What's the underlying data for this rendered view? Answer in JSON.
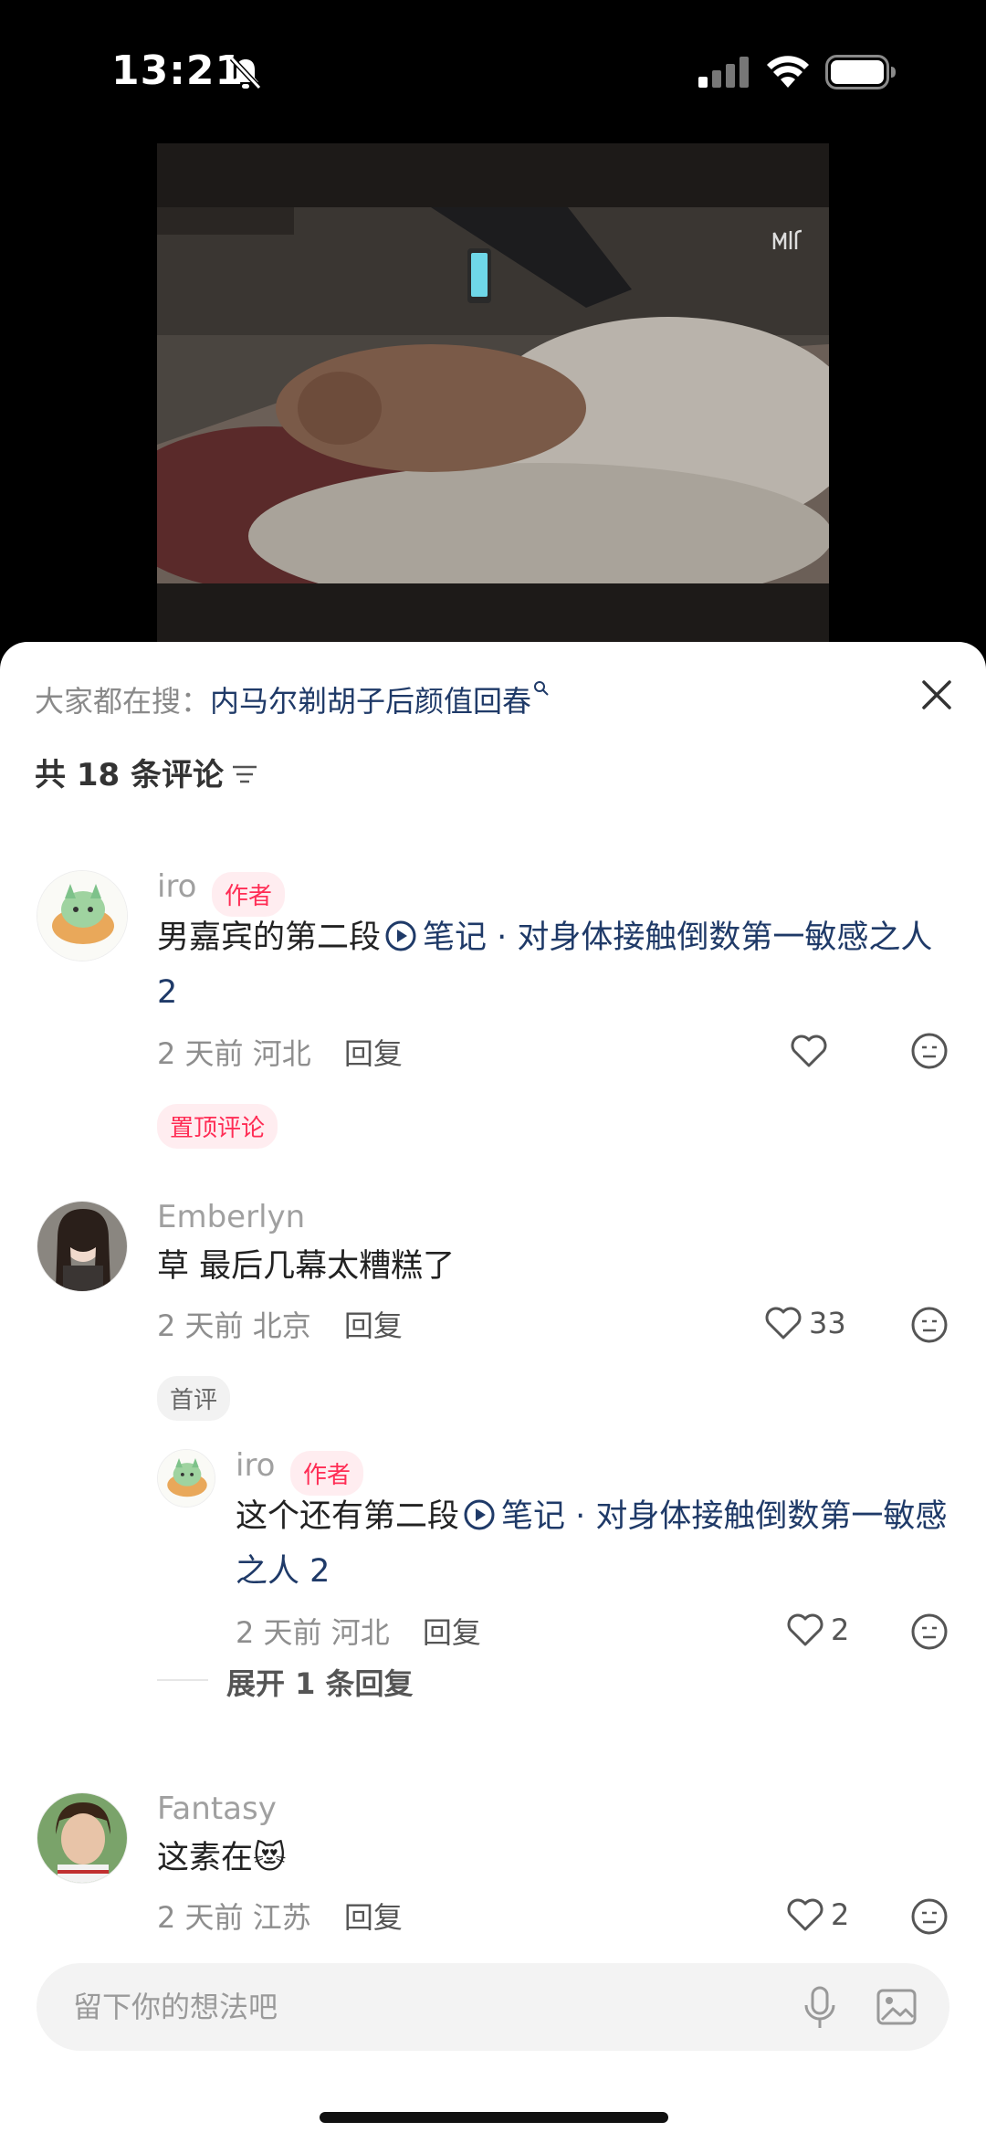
{
  "status_bar": {
    "time": "13:21"
  },
  "search_hint": {
    "prefix": "大家都在搜：",
    "term": "内马尔剃胡子后颜值回春"
  },
  "comments_header": {
    "count_label": "共 18 条评论"
  },
  "comments": [
    {
      "username": "iro",
      "badge": "作者",
      "text": "男嘉宾的第二段",
      "link_text": "笔记 · 对身体接触倒数第一敏感之人 2",
      "time": "2 天前",
      "location": "河北",
      "reply_label": "回复",
      "likes": "",
      "tag": "置顶评论"
    },
    {
      "username": "Emberlyn",
      "text": "草 最后几幕太糟糕了",
      "time": "2 天前",
      "location": "北京",
      "reply_label": "回复",
      "likes": "33",
      "tag": "首评",
      "replies": [
        {
          "username": "iro",
          "badge": "作者",
          "text": "这个还有第二段",
          "link_text": "笔记 · 对身体接触倒数第一敏感之人 2",
          "time": "2 天前",
          "location": "河北",
          "reply_label": "回复",
          "likes": "2"
        }
      ],
      "expand_label": "展开 1 条回复"
    },
    {
      "username": "Fantasy",
      "text": "这素在😻",
      "time": "2 天前",
      "location": "江苏",
      "reply_label": "回复",
      "likes": "2"
    }
  ],
  "input": {
    "placeholder": "留下你的想法吧"
  },
  "icons": {
    "bell": "bell-slash-icon",
    "signal": "cellular-signal-icon",
    "wifi": "wifi-icon",
    "battery": "battery-icon",
    "close": "close-icon",
    "sort": "sort-icon",
    "like": "heart-icon",
    "dislike": "neutral-face-icon",
    "play": "play-circle-icon",
    "mic": "microphone-icon",
    "image": "image-icon"
  },
  "colors": {
    "link": "#1f3a68",
    "badge": "#ff2d55",
    "badge_bg": "#ffedf0"
  }
}
